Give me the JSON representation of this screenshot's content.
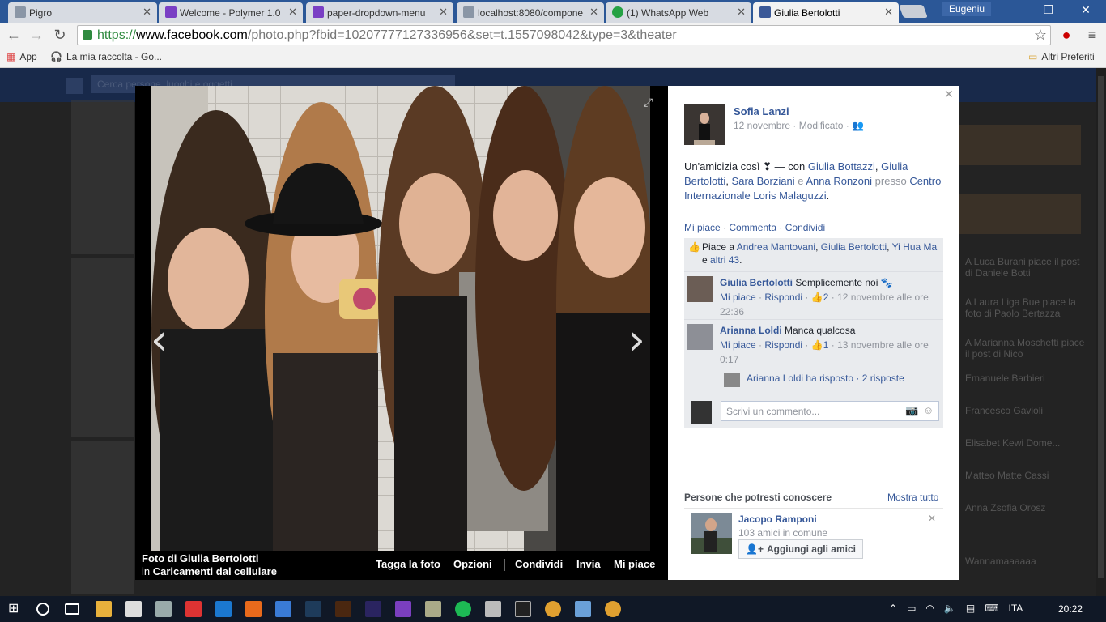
{
  "browser": {
    "tabs": [
      {
        "title": "Pigro",
        "color": "#6b7a8c"
      },
      {
        "title": "Welcome - Polymer 1.0",
        "color": "#7a3fc4"
      },
      {
        "title": "paper-dropdown-menu",
        "color": "#7a3fc4"
      },
      {
        "title": "localhost:8080/compone",
        "color": "#6b7a8c"
      },
      {
        "title": "(1) WhatsApp Web",
        "color": "#25a244"
      },
      {
        "title": "Giulia Bertolotti",
        "color": "#3b5998"
      }
    ],
    "user": "Eugeniu",
    "url_scheme": "https://",
    "url_host": "www.facebook.com",
    "url_path": "/photo.php?fbid=10207777127336956&set=t.1557098042&type=3&theater",
    "bookmarks": [
      "App",
      "La mia raccolta - Go..."
    ],
    "other_bookmarks": "Altri Preferiti"
  },
  "photo": {
    "caption_title": "Foto di Giulia Bertolotti",
    "caption_in": "in",
    "caption_album": "Caricamenti dal cellulare",
    "actions": [
      "Tagga la foto",
      "Opzioni",
      "Condividi",
      "Invia",
      "Mi piace"
    ]
  },
  "post": {
    "author": "Sofia Lanzi",
    "date": "12 novembre",
    "edited": "Modificato",
    "text_prefix": "Un'amicizia così ❣ — con",
    "tag1": "Giulia Bottazzi",
    "tag2": "Giulia Bertolotti",
    "tag3": "Sara Borziani",
    "and": "e",
    "tag4": "Anna Ronzoni",
    "at": "presso",
    "place": "Centro Internazionale Loris Malaguzzi",
    "actions": [
      "Mi piace",
      "Commenta",
      "Condividi"
    ],
    "likes_prefix": "Piace a",
    "liker1": "Andrea Mantovani",
    "liker2": "Giulia Bertolotti",
    "liker3": "Yi Hua Ma",
    "likes_and": "e",
    "likes_others": "altri 43"
  },
  "comments": [
    {
      "name": "Giulia Bertolotti",
      "text": "Semplicemente noi 🐾",
      "like": "Mi piace",
      "reply": "Rispondi",
      "count": "2",
      "time": "12 novembre alle ore 22:36"
    },
    {
      "name": "Arianna Loldi",
      "text": "Manca qualcosa",
      "like": "Mi piace",
      "reply": "Rispondi",
      "count": "1",
      "time": "13 novembre alle ore 0:17"
    }
  ],
  "reply_summary": {
    "who": "Arianna Loldi ha risposto",
    "count": "2 risposte"
  },
  "compose_placeholder": "Scrivi un commento...",
  "pymk": {
    "heading": "Persone che potresti conoscere",
    "see_all": "Mostra tutto",
    "name": "Jacopo Ramponi",
    "mutual": "103 amici in comune",
    "add": "Aggiungi agli amici"
  },
  "background": {
    "search": "Cerca persone, luoghi e oggetti",
    "feed": [
      "A Luca Burani piace il post di Daniele Botti",
      "A Laura Liga Bue piace la foto di Paolo Bertazza",
      "A Marianna Moschetti piace il post di Nico",
      "Emanuele Barbieri",
      "Francesco Gavioli",
      "Elisabet Kewi Dome...",
      "Matteo Matte Cassi",
      "Anna Zsofia Orosz",
      "Wannamaaaaaa"
    ]
  },
  "taskbar": {
    "lang": "ITA",
    "time": "20:22"
  }
}
